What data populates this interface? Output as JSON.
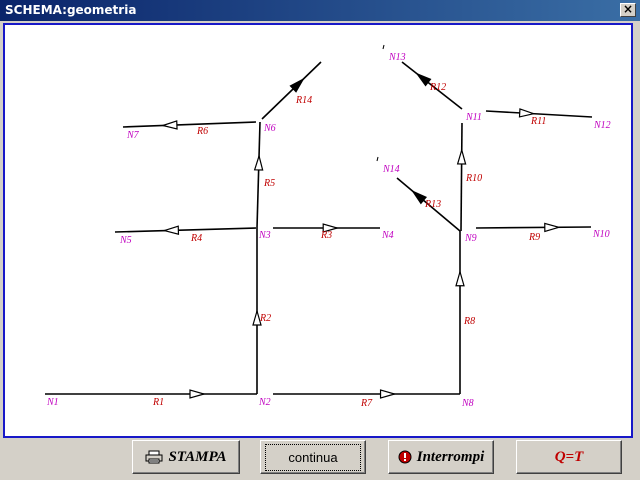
{
  "window": {
    "title": "SCHEMA:geometria",
    "close_label": "×"
  },
  "buttons": {
    "stampa": "STAMPA",
    "continua": "continua",
    "interrompi": "Interrompi",
    "qt": "Q=T"
  },
  "icons": {
    "printer": "printer-icon",
    "stop": "stop-icon"
  },
  "colors": {
    "node": "#c000c0",
    "branch": "#c00000",
    "frame": "#1818c8"
  },
  "schema": {
    "nodes": [
      {
        "id": "N1",
        "label": "N1"
      },
      {
        "id": "N2",
        "label": "N2"
      },
      {
        "id": "N3",
        "label": "N3"
      },
      {
        "id": "N4",
        "label": "N4"
      },
      {
        "id": "N5",
        "label": "N5"
      },
      {
        "id": "N6",
        "label": "N6"
      },
      {
        "id": "N7",
        "label": "N7"
      },
      {
        "id": "N8",
        "label": "N8"
      },
      {
        "id": "N9",
        "label": "N9"
      },
      {
        "id": "N10",
        "label": "N10"
      },
      {
        "id": "N11",
        "label": "N11"
      },
      {
        "id": "N12",
        "label": "N12"
      },
      {
        "id": "N13",
        "label": "N13"
      },
      {
        "id": "N14",
        "label": "N14"
      }
    ],
    "branches": [
      {
        "id": "R1",
        "label": "R1",
        "from": "N1",
        "to": "N2"
      },
      {
        "id": "R2",
        "label": "R2",
        "from": "N2",
        "to": "N3"
      },
      {
        "id": "R3",
        "label": "R3",
        "from": "N3",
        "to": "N4"
      },
      {
        "id": "R4",
        "label": "R4",
        "from": "N3",
        "to": "N5"
      },
      {
        "id": "R5",
        "label": "R5",
        "from": "N3",
        "to": "N6"
      },
      {
        "id": "R6",
        "label": "R6",
        "from": "N6",
        "to": "N7"
      },
      {
        "id": "R14",
        "label": "R14",
        "from": "N6",
        "to": ""
      },
      {
        "id": "R7",
        "label": "R7",
        "from": "N2",
        "to": "N8"
      },
      {
        "id": "R8",
        "label": "R8",
        "from": "N8",
        "to": "N9"
      },
      {
        "id": "R9",
        "label": "R9",
        "from": "N9",
        "to": "N10"
      },
      {
        "id": "R10",
        "label": "R10",
        "from": "N9",
        "to": "N11"
      },
      {
        "id": "R11",
        "label": "R11",
        "from": "N11",
        "to": "N12"
      },
      {
        "id": "R12",
        "label": "R12",
        "from": "N11",
        "to": "N13"
      },
      {
        "id": "R13",
        "label": "R13",
        "from": "N9",
        "to": "N14"
      }
    ]
  }
}
